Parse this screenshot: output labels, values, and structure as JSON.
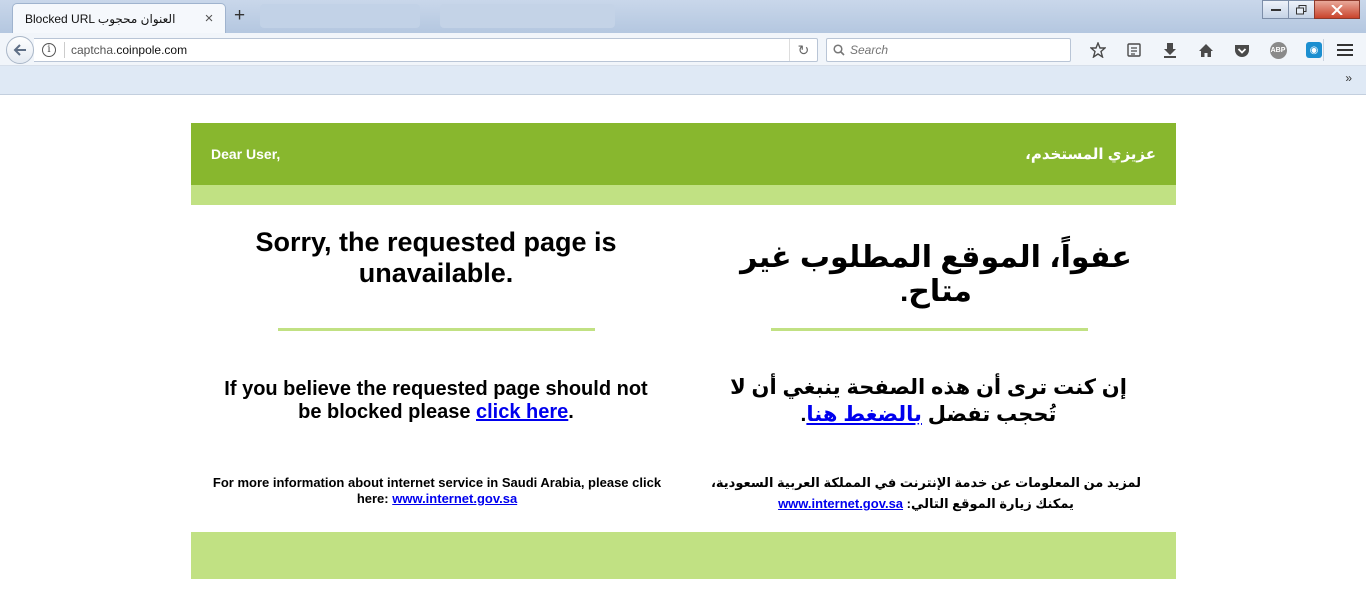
{
  "browser": {
    "tab_title": "Blocked URL العنوان محجوب",
    "tab_close": "×",
    "new_tab": "+",
    "url_host_prefix": "captcha.",
    "url_host_domain": "coinpole.com",
    "search_placeholder": "Search",
    "icons": [
      "back-arrow-icon",
      "info-icon",
      "reload-icon",
      "search-icon",
      "star-icon",
      "reading-list-icon",
      "download-icon",
      "home-icon",
      "pocket-icon",
      "adblock-icon",
      "extension-icon",
      "hamburger-menu-icon",
      "chevron-more-icon"
    ],
    "abp_label": "ABP",
    "more_label": "»"
  },
  "page": {
    "greeting_en": "Dear User,",
    "greeting_ar": "عزيزي المستخدم،",
    "heading_en": "Sorry, the requested page is unavailable.",
    "heading_ar": "عفواً، الموقع المطلوب غير متاح.",
    "para_en_before": "If you believe the requested page should not be blocked please ",
    "para_en_link": "click here",
    "para_en_after": ".",
    "para_ar_before": "إن كنت ترى أن هذه الصفحة ينبغي أن لا تُحجب تفضل ",
    "para_ar_link": "بالضغط هنا",
    "para_ar_after": ".",
    "more_en_text": "For more information about internet service in Saudi Arabia, please click here: ",
    "more_en_link": "www.internet.gov.sa",
    "more_ar_text": "لمزيد من المعلومات عن خدمة الإنترنت في المملكة العربية السعودية، يمكنك زيارة الموقع التالي: ",
    "more_ar_link": "www.internet.gov.sa",
    "colors": {
      "header_green": "#88b72e",
      "light_green": "#c1e183",
      "link": "#0000ee"
    }
  }
}
